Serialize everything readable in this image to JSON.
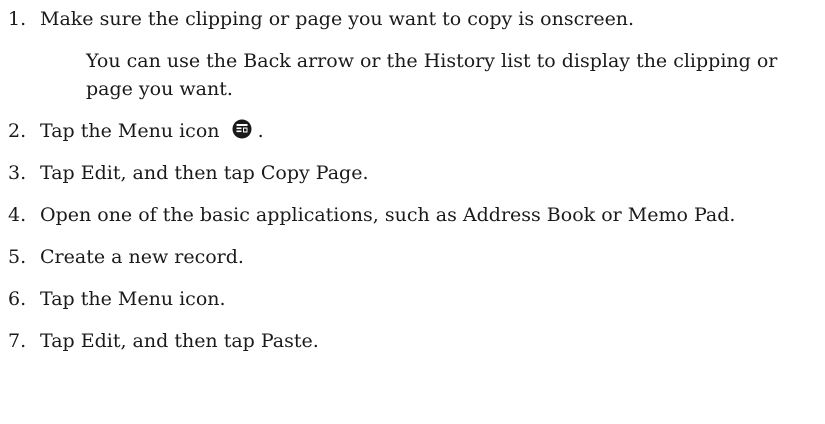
{
  "steps": [
    {
      "number": "1.",
      "text": "Make sure the clipping or page you want to copy is onscreen.",
      "sub": "You can use the Back arrow or the History list to display the clipping or page you want."
    },
    {
      "number": "2.",
      "text_before_icon": "Tap the Menu icon",
      "icon": "menu-icon",
      "text_after_icon": "."
    },
    {
      "number": "3.",
      "text": "Tap Edit, and then tap Copy Page."
    },
    {
      "number": "4.",
      "text": "Open one of the basic applications, such as Address Book or Memo Pad."
    },
    {
      "number": "5.",
      "text": "Create a new record."
    },
    {
      "number": "6.",
      "text": "Tap the Menu icon."
    },
    {
      "number": "7.",
      "text": "Tap Edit, and then tap Paste."
    }
  ]
}
